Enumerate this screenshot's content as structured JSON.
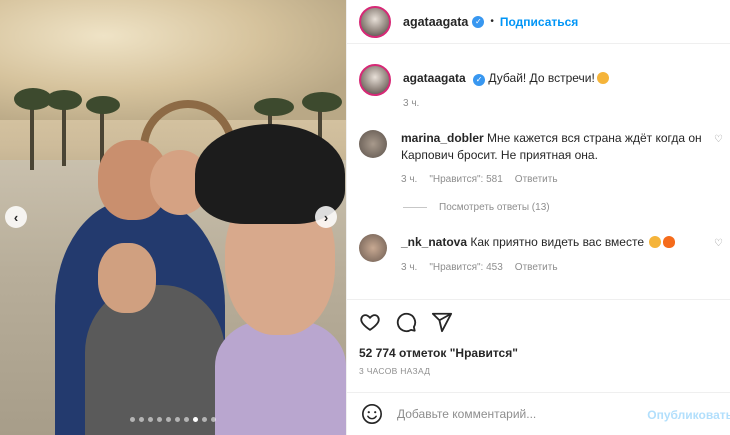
{
  "carousel": {
    "prev_icon": "chevron-left-icon",
    "next_icon": "chevron-right-icon",
    "slide_count": 10,
    "active_slide": 7
  },
  "header": {
    "username": "agataagata",
    "separator": "•",
    "follow_label": "Подписаться"
  },
  "caption": {
    "username": "agataagata",
    "text": "Дубай! До встречи!",
    "time": "3 ч."
  },
  "comments": [
    {
      "username": "marina_dobler",
      "text": "Мне кажется вся страна ждёт когда он Карпович бросит. Не приятная она.",
      "time": "3 ч.",
      "likes": "\"Нравится\": 581",
      "reply_label": "Ответить",
      "view_replies": "Посмотреть ответы (13)"
    },
    {
      "username": "_nk_natova",
      "text": "Как приятно видеть вас вместе",
      "time": "3 ч.",
      "likes": "\"Нравится\": 453",
      "reply_label": "Ответить"
    }
  ],
  "post": {
    "likes_text": "52 774 отметок \"Нравится\"",
    "timestamp": "3 ЧАСОВ НАЗАД"
  },
  "add_comment": {
    "placeholder": "Добавьте комментарий...",
    "publish_label": "Опубликовать"
  },
  "colors": {
    "accent": "#0095f6",
    "verified": "#3897f0",
    "muted": "#8e8e8e"
  }
}
